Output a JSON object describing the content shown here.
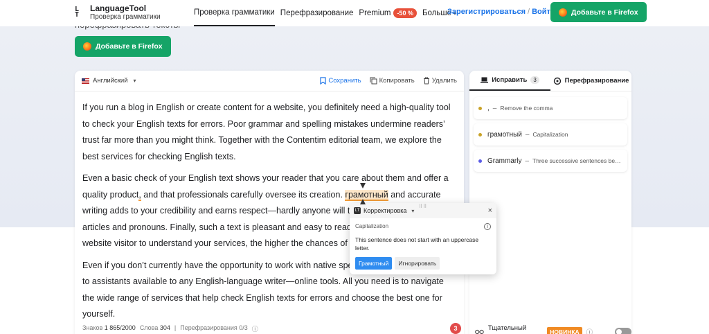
{
  "header": {
    "logo_title": "LanguageTool",
    "logo_sub": "Проверка грамматики",
    "nav": [
      {
        "label": "Проверка грамматики",
        "active": true
      },
      {
        "label": "Перефразирование"
      },
      {
        "label": "Premium",
        "badge": "-50 %"
      },
      {
        "label": "Больше"
      }
    ],
    "register": "Зарегистрироваться",
    "login": "Войти",
    "firefox_btn": "Добавьте в Firefox"
  },
  "hero": {
    "text": "перефразировать тексты",
    "firefox_btn": "Добавьте в Firefox"
  },
  "editor": {
    "language": "Английский",
    "save": "Сохранить",
    "copy": "Копировать",
    "delete": "Удалить",
    "p1": "If you run a blog in English or create content for a website, you definitely need a high-quality tool to check your English texts for errors. Poor grammar and spelling mistakes undermine readers’ trust far more than you might think. Together with the Contentim editorial team, we explore the best services for checking English texts.",
    "p2_a": "Even a basic check of your English text shows your reader that you care about them and offer a quality product",
    "p2_comma": ",",
    "p2_b": " and that professionals carefully oversee its creation. ",
    "p2_mark": "грамотный",
    "p2_c": " and accurate writing adds to your credibility and earns respect—hardly anyone will trust a text that confuses articles and pronouns. Finally, such a text is pleasant and easy to read: the easier it is for a website visitor to understand your services, the higher the chances of success.",
    "p3": "Even if you don’t currently have the opportunity to work with native speakers, you can always turn to assistants available to any English-language writer—online tools. All you need is to navigate the wide range of services that help check English texts for errors and choose the best one for yourself.",
    "footer": {
      "chars_label": "Знаков",
      "chars_value": "1 865/2000",
      "words_label": "Слова",
      "words_value": "304",
      "rephrase": "Перефразирования 0/3"
    },
    "error_count": "3"
  },
  "sidepanel": {
    "tab_fix": "Исправить",
    "tab_fix_count": "3",
    "tab_rephrase": "Перефразирование",
    "suggestions": [
      {
        "word": ",",
        "desc": "Remove the comma",
        "color": "#c9a227"
      },
      {
        "word": "грамотный",
        "desc": "Capitalization",
        "color": "#c9a227"
      },
      {
        "word": "Grammarly",
        "desc": "Three successive sentences be…",
        "color": "#5b5ce6"
      }
    ],
    "careful_mode": "Тщательный режим",
    "new_badge": "НОВИНКА"
  },
  "popup": {
    "title": "Корректировка",
    "category": "Capitalization",
    "message": "This sentence does not start with an uppercase letter.",
    "accept": "Грамотный",
    "ignore": "Игнорировать"
  },
  "colors": {
    "accent_green": "#15a467",
    "link_blue": "#1a73e8",
    "error_red": "#e24b4b",
    "warning_orange": "#f29b37"
  }
}
